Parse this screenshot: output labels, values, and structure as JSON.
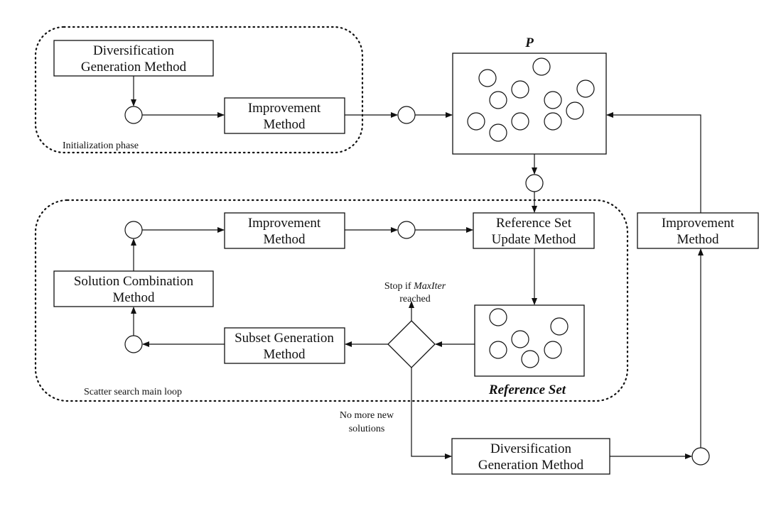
{
  "init_phase": {
    "label": "Initialization phase",
    "div_gen": [
      "Diversification",
      "Generation Method"
    ],
    "improvement": [
      "Improvement",
      "Method"
    ]
  },
  "population": {
    "label": "P",
    "solutions": 11
  },
  "main_loop": {
    "label": "Scatter search main loop",
    "improvement": [
      "Improvement",
      "Method"
    ],
    "ref_update": [
      "Reference Set",
      "Update Method"
    ],
    "sol_comb": [
      "Solution Combination",
      "Method"
    ],
    "subset_gen": [
      "Subset Generation",
      "Method"
    ],
    "ref_set_label": "Reference Set",
    "ref_set_solutions": 6,
    "stop_label": {
      "prefix": "Stop if ",
      "italic": "MaxIter",
      "line2": "reached"
    }
  },
  "no_more": [
    "No more new",
    "solutions"
  ],
  "div_gen_bottom": [
    "Diversification",
    "Generation Method"
  ],
  "improvement_right": [
    "Improvement",
    "Method"
  ]
}
